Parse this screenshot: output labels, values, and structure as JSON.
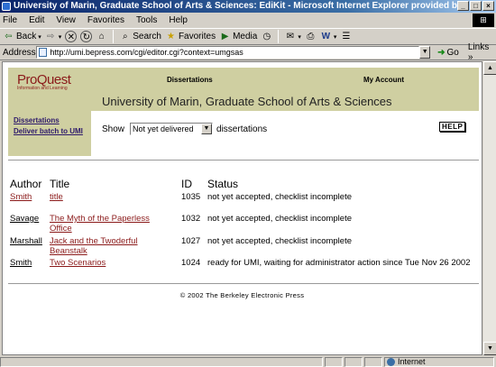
{
  "window": {
    "title": "University of Marin, Graduate School of Arts & Sciences: EdiKit - Microsoft Internet Explorer provided by ProQuest Enterprise S",
    "minimize": "_",
    "maximize": "□",
    "close": "×"
  },
  "menu": [
    "File",
    "Edit",
    "View",
    "Favorites",
    "Tools",
    "Help"
  ],
  "toolbar": {
    "back": "Back",
    "search": "Search",
    "favorites": "Favorites",
    "media": "Media"
  },
  "address": {
    "label": "Address",
    "url": "http://umi.bepress.com/cgi/editor.cgi?context=umgsas",
    "go": "Go",
    "links": "Links"
  },
  "header": {
    "logo_main": "ProQuest",
    "logo_sub": "Information and Learning",
    "nav_dissertations": "Dissertations",
    "nav_account": "My Account",
    "institution": "University of Marin, Graduate School of Arts & Sciences"
  },
  "sidebar": {
    "items": [
      {
        "label": "Dissertations"
      },
      {
        "label": "Deliver batch to UMI"
      }
    ]
  },
  "filter": {
    "show_label": "Show",
    "selected": "Not yet delivered",
    "suffix": "dissertations",
    "help": "HELP"
  },
  "table": {
    "headers": {
      "author": "Author",
      "title": "Title",
      "id": "ID",
      "status": "Status"
    },
    "rows": [
      {
        "author": "Smith",
        "title": "title",
        "id": "1035",
        "status": "not yet accepted, checklist incomplete"
      },
      {
        "author": "Savage",
        "title": "The Myth of the Paperless Office",
        "id": "1032",
        "status": "not yet accepted, checklist incomplete"
      },
      {
        "author": "Marshall",
        "title": "Jack and the Twoderful Beanstalk",
        "id": "1027",
        "status": "not yet accepted, checklist incomplete"
      },
      {
        "author": "Smith",
        "title": "Two Scenarios",
        "id": "1024",
        "status": "ready for UMI, waiting for administrator action since Tue Nov 26 2002"
      }
    ]
  },
  "footer": {
    "text": "© 2002 The Berkeley Electronic Press"
  },
  "status_bar": {
    "zone": "Internet"
  }
}
